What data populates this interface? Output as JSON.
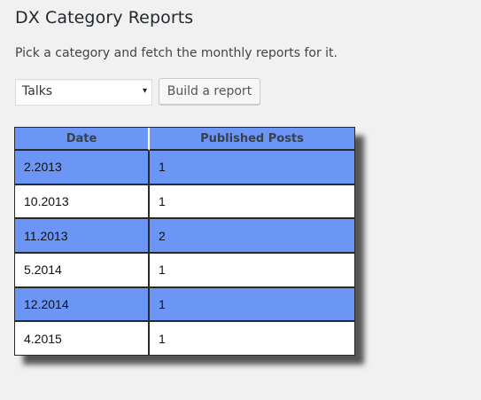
{
  "page": {
    "title": "DX Category Reports",
    "subtitle": "Pick a category and fetch the monthly reports for it."
  },
  "form": {
    "category_select": {
      "selected_value": "Talks",
      "caret_icon": "▾"
    },
    "build_button_label": "Build a report"
  },
  "table": {
    "headers": {
      "date": "Date",
      "published_posts": "Published Posts"
    },
    "rows": [
      {
        "date": "2.2013",
        "posts": "1"
      },
      {
        "date": "10.2013",
        "posts": "1"
      },
      {
        "date": "11.2013",
        "posts": "2"
      },
      {
        "date": "5.2014",
        "posts": "1"
      },
      {
        "date": "12.2014",
        "posts": "1"
      },
      {
        "date": "4.2015",
        "posts": "1"
      }
    ]
  },
  "colors": {
    "background": "#f1f1f1",
    "highlight_row": "#6b96f5",
    "plain_row": "#ffffff",
    "border": "#2a2a2a"
  }
}
